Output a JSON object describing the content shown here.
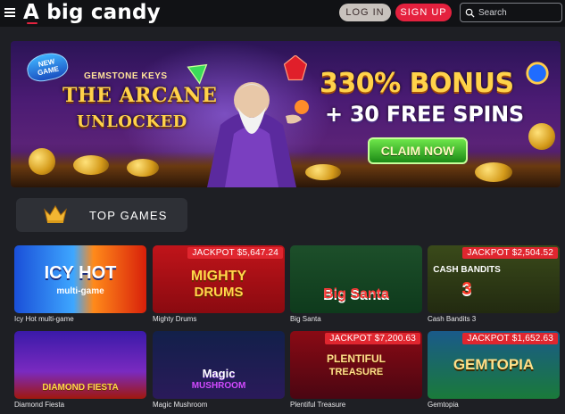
{
  "header": {
    "logo": "A big candy",
    "login_label": "LOG IN",
    "signup_label": "SIGN UP",
    "search_placeholder": "Search",
    "icons": [
      "hamburger-menu-icon",
      "search-icon"
    ]
  },
  "banner": {
    "badge": "NEW GAME",
    "subtitle": "GEMSTONE KEYS",
    "title_line1": "THE ARCANE",
    "title_line2": "UNLOCKED",
    "offer_line1": "330% BONUS",
    "offer_line2": "+ 30 FREE SPINS",
    "cta_label": "CLAIM NOW"
  },
  "section": {
    "label": "TOP GAMES",
    "icon": "crown-icon"
  },
  "games": [
    {
      "name": "Icy Hot multi-game",
      "art_line1": "ICY HOT",
      "art_line2": "multi-game",
      "jackpot": ""
    },
    {
      "name": "Mighty Drums",
      "art_line1": "MIGHTY",
      "art_line2": "DRUMS",
      "jackpot": "JACKPOT $5,647.24"
    },
    {
      "name": "Big Santa",
      "art_line1": "Big Santa",
      "art_line2": "",
      "jackpot": ""
    },
    {
      "name": "Cash Bandits 3",
      "art_line1": "CASH BANDITS",
      "art_line2": "3",
      "jackpot": "JACKPOT $2,504.52"
    },
    {
      "name": "Diamond Fiesta",
      "art_line1": "DIAMOND FIESTA",
      "art_line2": "",
      "jackpot": ""
    },
    {
      "name": "Magic Mushroom",
      "art_line1": "Magic",
      "art_line2": "MUSHROOM",
      "jackpot": ""
    },
    {
      "name": "Plentiful Treasure",
      "art_line1": "PLENTIFUL",
      "art_line2": "TREASURE",
      "jackpot": "JACKPOT $7,200.63"
    },
    {
      "name": "Gemtopia",
      "art_line1": "GEMTOPIA",
      "art_line2": "",
      "jackpot": "JACKPOT $1,652.63"
    }
  ],
  "colors": {
    "background": "#1e1f24",
    "header": "#111215",
    "signup": "#e5213e",
    "login": "#c8c2bd",
    "jackpot": "#e0262f",
    "tab": "#2e3036"
  }
}
